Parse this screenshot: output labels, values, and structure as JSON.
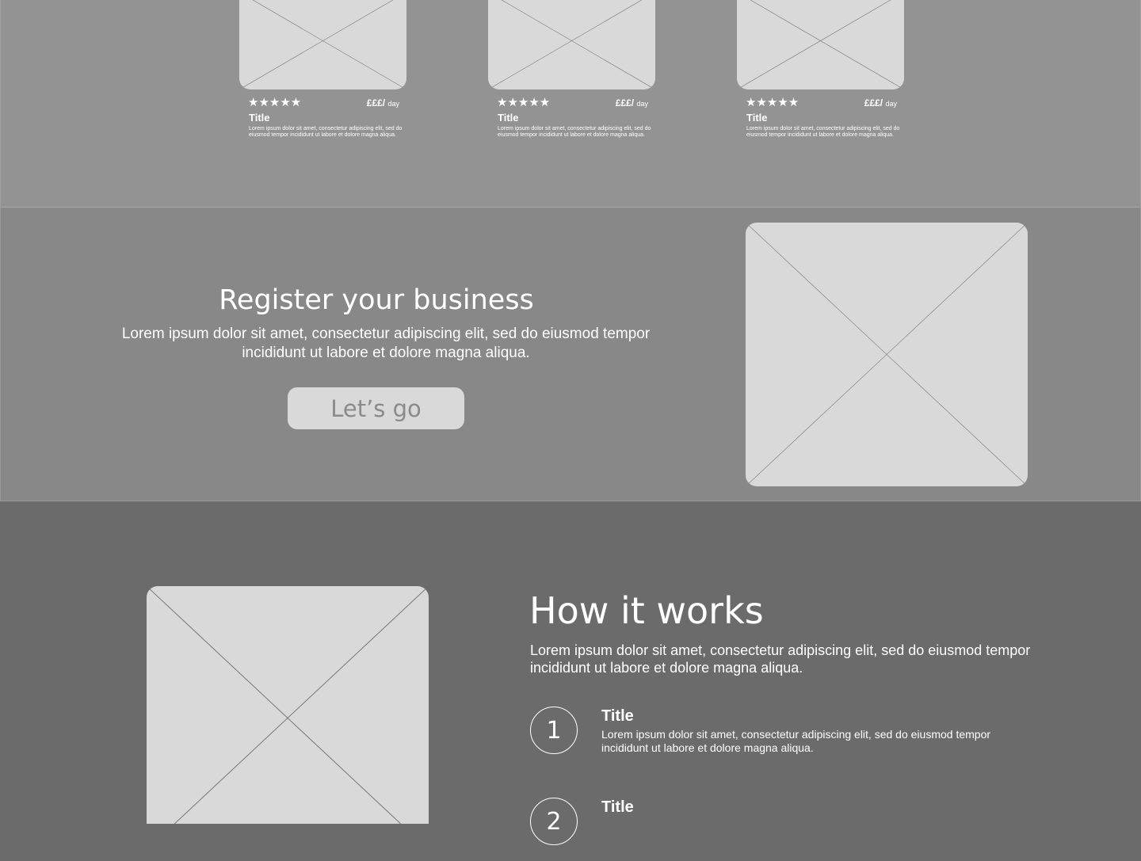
{
  "cards": [
    {
      "rating_stars": "★★★★★",
      "price": "£££/",
      "price_unit": "day",
      "title": "Title",
      "description": "Lorem ipsum dolor sit amet, consectetur adipiscing elit, sed do eiusmod tempor incididunt ut labore et dolore magna aliqua."
    },
    {
      "rating_stars": "★★★★★",
      "price": "£££/",
      "price_unit": "day",
      "title": "Title",
      "description": "Lorem ipsum dolor sit amet, consectetur adipiscing elit, sed do eiusmod tempor incididunt ut labore et dolore magna aliqua."
    },
    {
      "rating_stars": "★★★★★",
      "price": "£££/",
      "price_unit": "day",
      "title": "Title",
      "description": "Lorem ipsum dolor sit amet, consectetur adipiscing elit, sed do eiusmod tempor incididunt ut labore et dolore magna aliqua."
    }
  ],
  "register": {
    "title": "Register your business",
    "text": "Lorem ipsum dolor sit amet, consectetur adipiscing elit, sed do eiusmod tempor incididunt ut labore et dolore magna aliqua.",
    "button_label": "Let’s go"
  },
  "how_it_works": {
    "title": "How it works",
    "text": "Lorem ipsum dolor sit amet, consectetur adipiscing elit, sed do eiusmod tempor incididunt ut labore et dolore magna aliqua.",
    "steps": [
      {
        "number": "1",
        "title": "Title",
        "description": "Lorem ipsum dolor sit amet, consectetur adipiscing elit, sed do eiusmod tempor incididunt ut labore et dolore magna aliqua."
      },
      {
        "number": "2",
        "title": "Title",
        "description": ""
      }
    ]
  },
  "colors": {
    "cards_section_bg": "#939393",
    "register_section_bg": "#888888",
    "how_section_bg": "#6b6b6b",
    "placeholder": "#d9d9d9",
    "text": "#ffffff"
  }
}
